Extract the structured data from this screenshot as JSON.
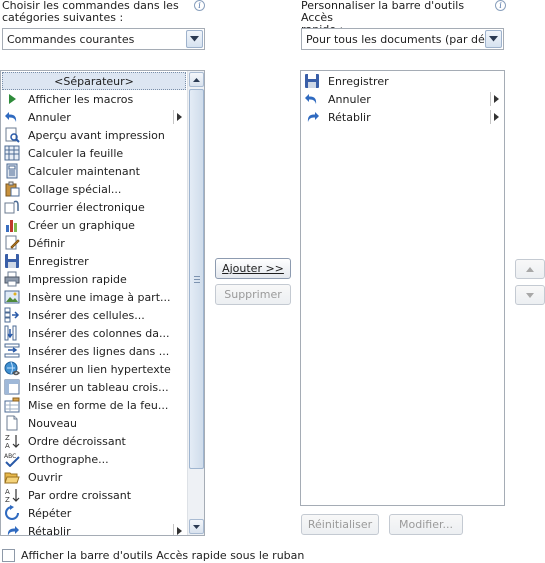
{
  "left_header": {
    "label_line1": "Choisir les commandes dans les",
    "label_line2": "catégories suivantes :",
    "combo_value": "Commandes courantes",
    "info_icon": "info-icon"
  },
  "right_header": {
    "label_line1": "Personnaliser la barre d'outils Accès",
    "label_line2": "rapide :",
    "combo_value": "Pour tous les documents (par dé...",
    "info_icon": "info-icon"
  },
  "commands": [
    {
      "label": "<Séparateur>",
      "icon": "separator",
      "submenu": false
    },
    {
      "label": "Afficher les macros",
      "icon": "play-triangle-icon",
      "submenu": false
    },
    {
      "label": "Annuler",
      "icon": "undo-icon",
      "submenu": true
    },
    {
      "label": "Aperçu avant impression",
      "icon": "print-preview-icon",
      "submenu": false
    },
    {
      "label": "Calculer la feuille",
      "icon": "calculator-sheet-icon",
      "submenu": false
    },
    {
      "label": "Calculer maintenant",
      "icon": "calculator-icon",
      "submenu": false
    },
    {
      "label": "Collage spécial...",
      "icon": "paste-special-icon",
      "submenu": false
    },
    {
      "label": "Courrier électronique",
      "icon": "email-icon",
      "submenu": false
    },
    {
      "label": "Créer un graphique",
      "icon": "chart-icon",
      "submenu": false
    },
    {
      "label": "Définir",
      "icon": "define-name-icon",
      "submenu": false
    },
    {
      "label": "Enregistrer",
      "icon": "save-icon",
      "submenu": false
    },
    {
      "label": "Impression rapide",
      "icon": "quick-print-icon",
      "submenu": false
    },
    {
      "label": "Insère une image à part...",
      "icon": "insert-picture-icon",
      "submenu": false
    },
    {
      "label": "Insérer des cellules...",
      "icon": "insert-cells-icon",
      "submenu": false
    },
    {
      "label": "Insérer des colonnes da...",
      "icon": "insert-columns-icon",
      "submenu": false
    },
    {
      "label": "Insérer des lignes dans ...",
      "icon": "insert-rows-icon",
      "submenu": false
    },
    {
      "label": "Insérer un lien hypertexte",
      "icon": "hyperlink-icon",
      "submenu": false
    },
    {
      "label": "Insérer un tableau crois...",
      "icon": "pivot-table-icon",
      "submenu": false
    },
    {
      "label": "Mise en forme de la feu...",
      "icon": "format-sheet-icon",
      "submenu": false
    },
    {
      "label": "Nouveau",
      "icon": "new-document-icon",
      "submenu": false
    },
    {
      "label": "Ordre décroissant",
      "icon": "sort-descending-icon",
      "submenu": false
    },
    {
      "label": "Orthographe...",
      "icon": "spelling-icon",
      "submenu": false
    },
    {
      "label": "Ouvrir",
      "icon": "open-folder-icon",
      "submenu": false
    },
    {
      "label": "Par ordre croissant",
      "icon": "sort-ascending-icon",
      "submenu": false
    },
    {
      "label": "Répéter",
      "icon": "repeat-icon",
      "submenu": false
    },
    {
      "label": "Rétablir",
      "icon": "redo-icon",
      "submenu": true
    }
  ],
  "toolbar_items": [
    {
      "label": "Enregistrer",
      "icon": "save-icon",
      "submenu": false
    },
    {
      "label": "Annuler",
      "icon": "undo-icon",
      "submenu": true
    },
    {
      "label": "Rétablir",
      "icon": "redo-icon",
      "submenu": true
    }
  ],
  "buttons": {
    "add": "Ajouter >>",
    "remove": "Supprimer",
    "reset": "Réinitialiser",
    "modify": "Modifier..."
  },
  "checkbox": {
    "label": "Afficher la barre d'outils Accès rapide sous le ruban",
    "checked": false
  },
  "colors": {
    "accent": "#3a6fb7",
    "separator_bg": "#dde6f2"
  }
}
